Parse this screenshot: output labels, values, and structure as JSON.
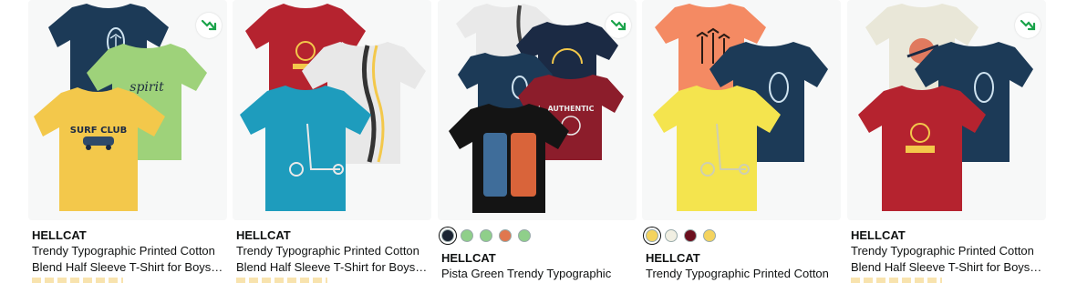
{
  "products": [
    {
      "brand": "HELLCAT",
      "title": "Trendy Typographic Printed Cotton Blend Half Sleeve T-Shirt for Boys -...",
      "trending_icon": "trending-down-icon",
      "shirts": [
        {
          "color": "#1c3a57",
          "print": "palm-oval"
        },
        {
          "color": "#9ed27a",
          "print": "spirit"
        },
        {
          "color": "#f3c84b",
          "print": "surf-club"
        }
      ],
      "shirt_text": {
        "spirit": "spirit",
        "surf_club": "SURF CLUB"
      },
      "swatches": []
    },
    {
      "brand": "HELLCAT",
      "title": "Trendy Typographic Printed Cotton Blend Half Sleeve T-Shirt for Boys -...",
      "trending_icon": "",
      "shirts": [
        {
          "color": "#b5232f",
          "print": "tree-badge"
        },
        {
          "color": "#e8e8e8",
          "print": "wavy-stripe"
        },
        {
          "color": "#1e9cbd",
          "print": "scooter"
        }
      ],
      "swatches": []
    },
    {
      "brand": "HELLCAT",
      "title": "Pista Green Trendy Typographic",
      "trending_icon": "trending-down-icon",
      "shirts": [
        {
          "color": "#e9e9e9",
          "print": "wavy-stripe"
        },
        {
          "color": "#1b2a44",
          "print": "sun-arch"
        },
        {
          "color": "#1c3a57",
          "print": "palm-oval"
        },
        {
          "color": "#8c1d2b",
          "print": "authentic"
        },
        {
          "color": "#141414",
          "print": "graffiti"
        }
      ],
      "shirt_text": {
        "authentic": "AUTHENTIC"
      },
      "swatches": [
        "#1b2433",
        "#8fcf8a",
        "#8fcf8a",
        "#e0774f",
        "#8fcf8a"
      ],
      "swatch_selected": 0
    },
    {
      "brand": "HELLCAT",
      "title": "Trendy Typographic Printed Cotton",
      "trending_icon": "",
      "shirts": [
        {
          "color": "#f48a63",
          "print": "palm-trees"
        },
        {
          "color": "#1c3a57",
          "print": "palm-oval"
        },
        {
          "color": "#f4e44e",
          "print": "scooter"
        }
      ],
      "swatches": [
        "#f4d35e",
        "#f1efe2",
        "#6b0f1e",
        "#f4d35e"
      ],
      "swatch_selected": 0
    },
    {
      "brand": "HELLCAT",
      "title": "Trendy Typographic Printed Cotton Blend Half Sleeve T-Shirt for Boys -...",
      "trending_icon": "trending-down-icon",
      "shirts": [
        {
          "color": "#e9e7d8",
          "print": "skate"
        },
        {
          "color": "#1c3a57",
          "print": "palm-oval"
        },
        {
          "color": "#b5232f",
          "print": "tree-badge"
        }
      ],
      "swatches": []
    }
  ],
  "colors": {
    "trend": "#1aa34a",
    "text": "#0f1111",
    "image_bg": "#f7f8f8"
  }
}
